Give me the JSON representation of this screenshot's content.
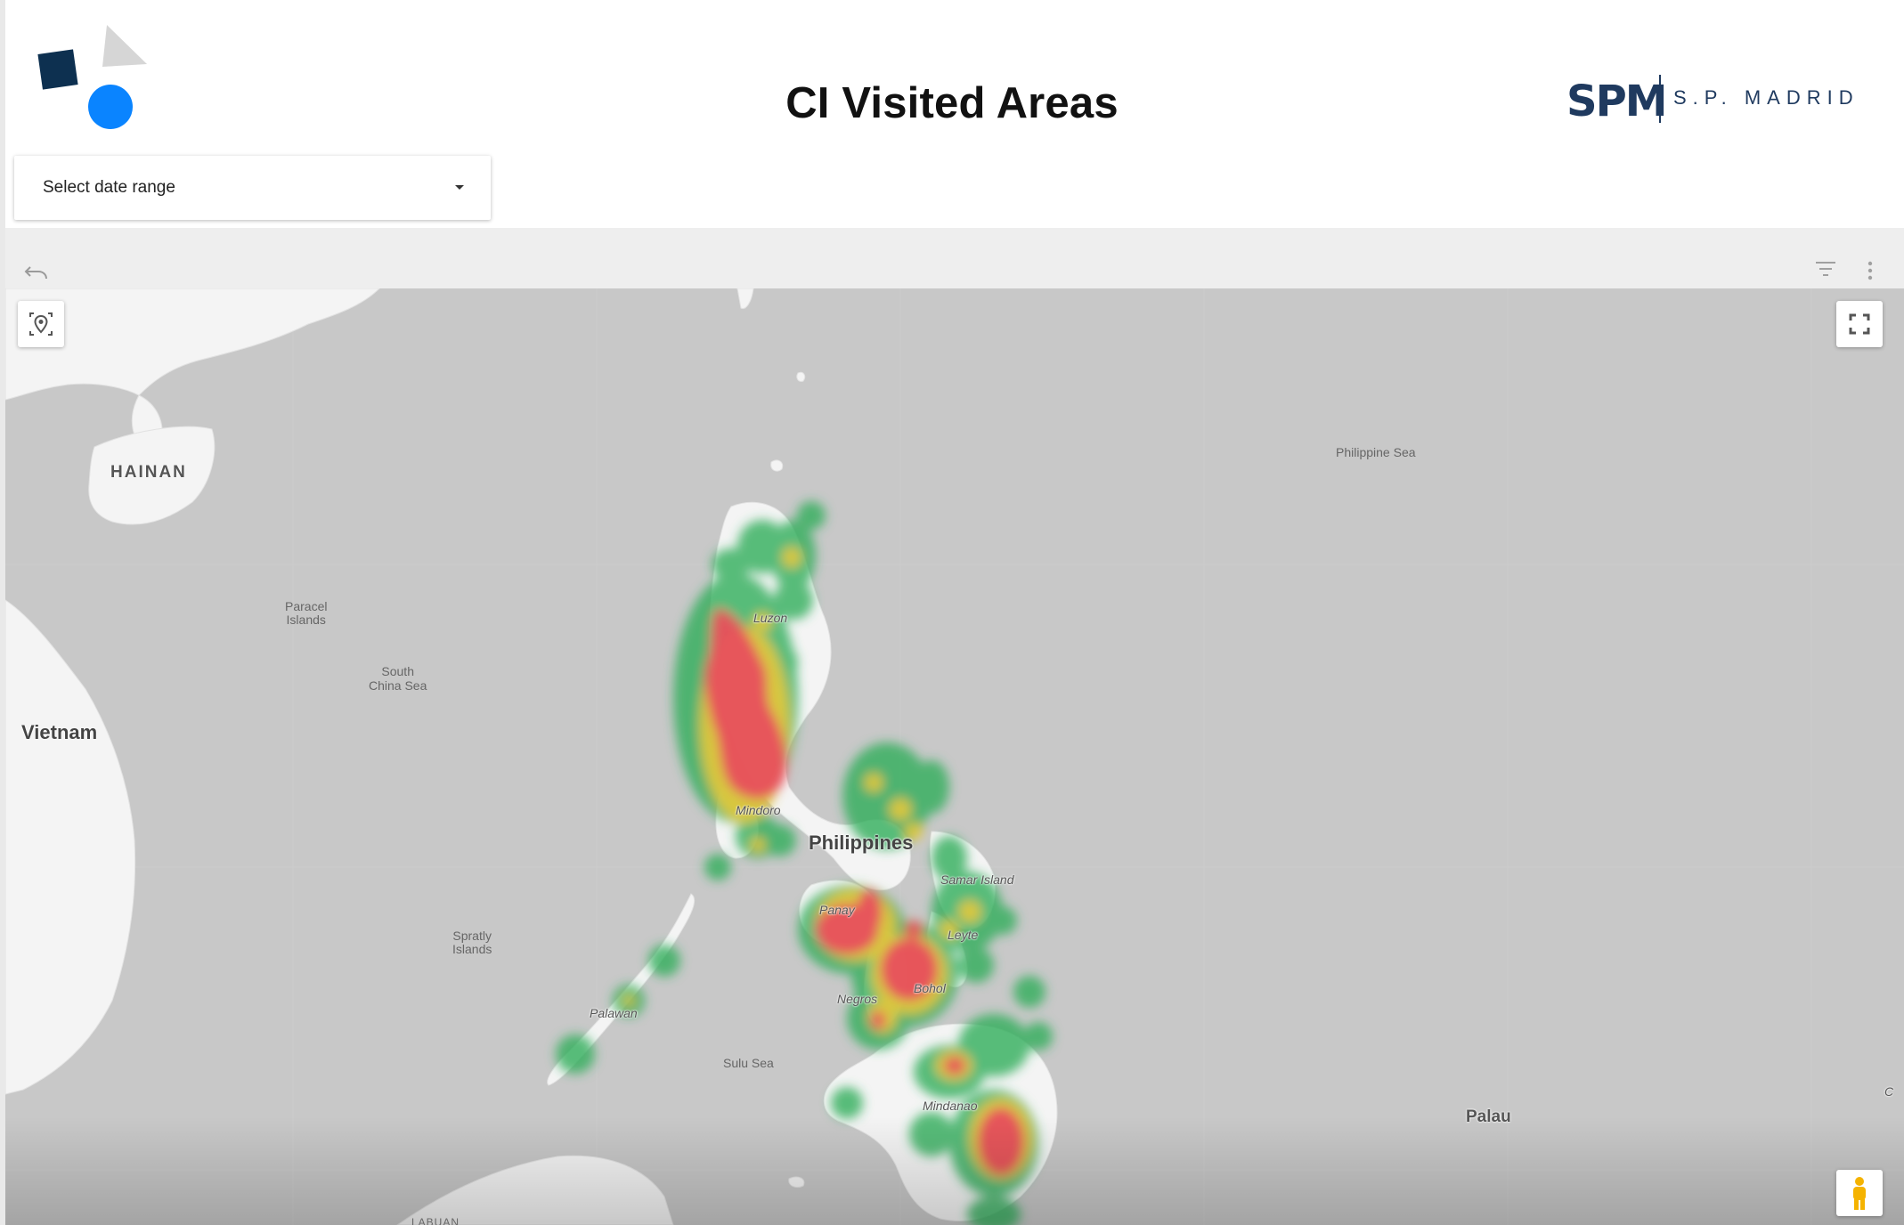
{
  "header": {
    "title": "CI Visited Areas",
    "brand_mark": "SPM",
    "brand_name": "S.P. MADRID"
  },
  "filter": {
    "date_range_label": "Select date range"
  },
  "toolbar": {
    "undo_icon": "undo-icon",
    "filter_icon": "filter-icon",
    "more_icon": "more-vert-icon"
  },
  "map": {
    "controls": {
      "locate_icon": "locate-pin-icon",
      "fullscreen_icon": "fullscreen-icon",
      "pegman_icon": "street-view-pegman-icon"
    },
    "labels": {
      "hainan": "HAINAN",
      "paracel": "Paracel\nIslands",
      "south_china_sea": "South\nChina Sea",
      "vietnam": "Vietnam",
      "spratly": "Spratly\nIslands",
      "palawan": "Palawan",
      "sulu_sea": "Sulu Sea",
      "luzon": "Luzon",
      "mindoro": "Mindoro",
      "philippines": "Philippines",
      "samar": "Samar Island",
      "panay": "Panay",
      "leyte": "Leyte",
      "negros": "Negros",
      "bohol": "Bohol",
      "mindanao": "Mindanao",
      "philippine_sea": "Philippine Sea",
      "palau": "Palau",
      "labuan": "LABUAN",
      "edge_c": "C"
    },
    "heat_colors": {
      "low": "#2fae5c",
      "mid": "#e6c93a",
      "high": "#e8505b"
    }
  }
}
